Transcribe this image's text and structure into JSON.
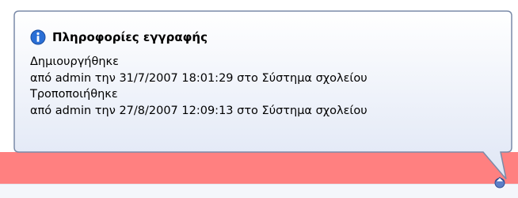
{
  "tooltip": {
    "title": "Πληροφορίες εγγραφής",
    "icon": "info-icon",
    "lines": [
      "Δημιουργήθηκε",
      "από admin την 31/7/2007 18:01:29 στο Σύστημα σχολείου",
      "Τροποποιήθηκε",
      "από admin την 27/8/2007 12:09:13 στο Σύστημα σχολείου"
    ]
  },
  "colors": {
    "tooltip_bg_top": "#ffffff",
    "tooltip_bg_bottom": "#dfe6f5",
    "tooltip_border": "#7a8aa8",
    "row_highlight": "#ff8080",
    "info_icon_blue": "#2a6fd6"
  },
  "status_icon": "record-status-icon"
}
